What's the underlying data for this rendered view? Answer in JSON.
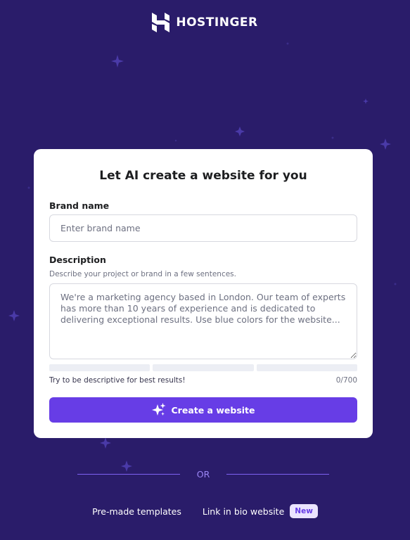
{
  "brand": {
    "name": "HOSTINGER",
    "logo_icon": "hostinger-h-logo"
  },
  "card": {
    "title": "Let AI create a website for you",
    "brand_name": {
      "label": "Brand name",
      "placeholder": "Enter brand name",
      "value": ""
    },
    "description": {
      "label": "Description",
      "hint": "Describe your project or brand in a few sentences.",
      "placeholder": "We're a marketing agency based in London. Our team of experts has more than 10 years of experience and is dedicated to delivering exceptional results. Use blue colors for the website...",
      "value": ""
    },
    "progress": {
      "segments": 3,
      "filled": 0
    },
    "footer_hint": "Try to be descriptive for best results!",
    "char_counter": "0/700",
    "create_button": {
      "label": "Create a website",
      "icon": "sparkles-icon"
    }
  },
  "divider": {
    "label": "OR"
  },
  "bottom_links": {
    "templates": "Pre-made templates",
    "link_in_bio": "Link in bio website",
    "new_badge": "New"
  },
  "colors": {
    "background": "#2a1c6a",
    "accent": "#673de6",
    "card": "#ffffff",
    "badge_bg": "#ebe4ff"
  }
}
